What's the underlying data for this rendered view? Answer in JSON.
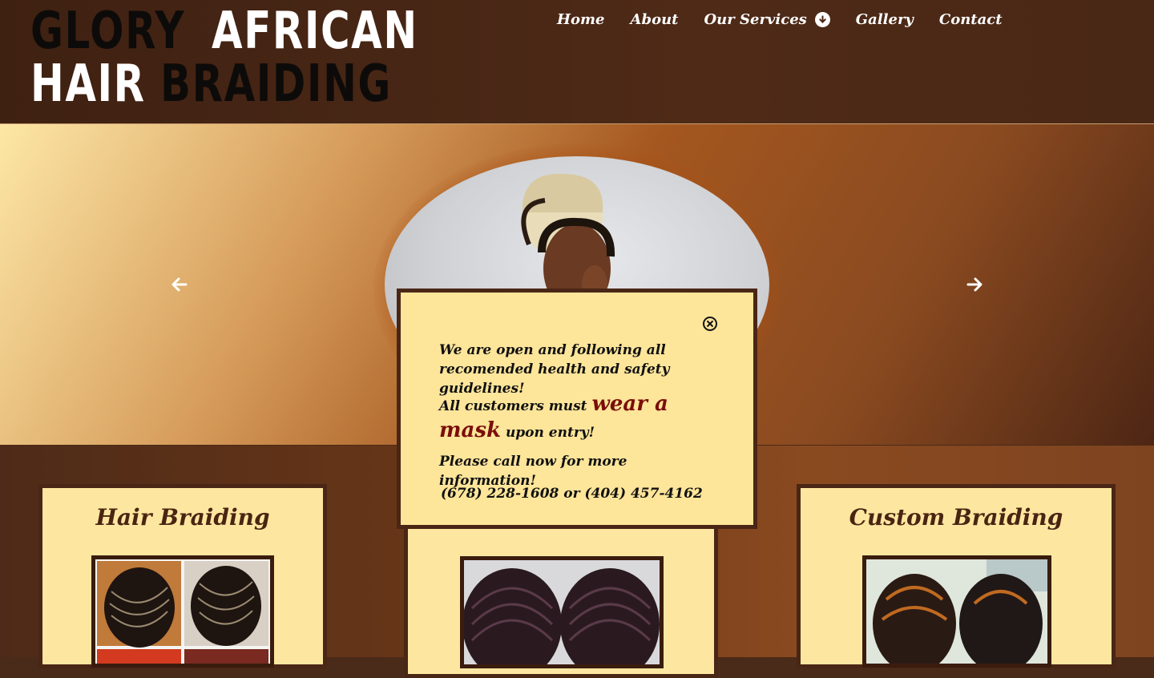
{
  "logo": {
    "line1_a": "GLORY",
    "line1_b": "AFRICAN",
    "line2_a": "HAIR",
    "line2_b": "BRAIDING"
  },
  "nav": {
    "home": "Home",
    "about": "About",
    "services": "Our Services",
    "gallery": "Gallery",
    "contact": "Contact"
  },
  "hero": {
    "prev_icon": "arrow-left-icon",
    "next_icon": "arrow-right-icon"
  },
  "cards": [
    {
      "title": "Hair Braiding"
    },
    {
      "title": ""
    },
    {
      "title": "Custom Braiding"
    }
  ],
  "popup": {
    "line1": "We are open and following all recomended health and safety guidelines!",
    "line2_pre": "All customers must",
    "line2_emph": "wear a mask",
    "line2_post": "upon entry!",
    "line3": "Please call now for more information!",
    "phones": "(678) 228-1608 or  (404) 457-4162",
    "close_icon": "close-icon"
  },
  "colors": {
    "brown_dark": "#4a2616",
    "cream": "#fde7a0",
    "mask_red": "#7a0f0a"
  }
}
